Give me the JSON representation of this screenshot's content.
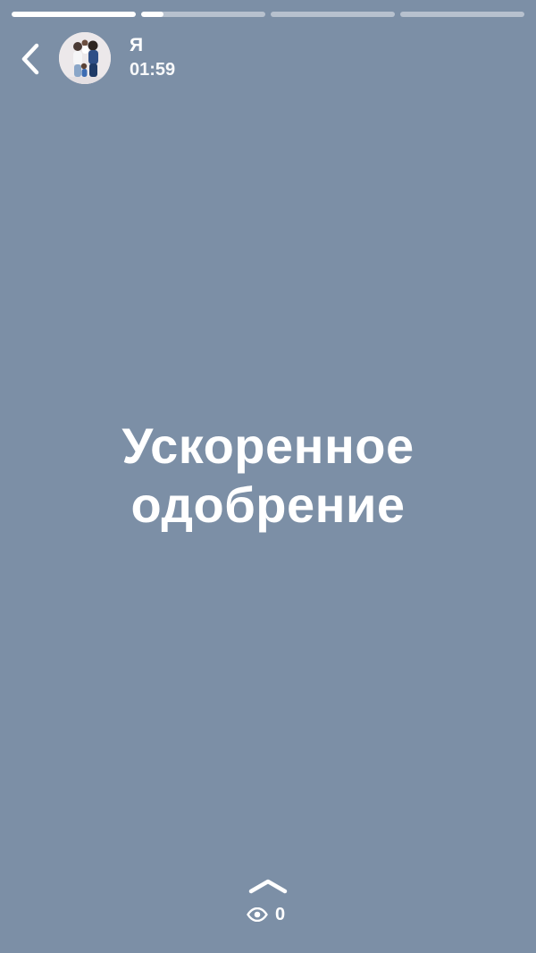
{
  "story": {
    "background_color": "#7c8fa6",
    "progress_segments": [
      {
        "fill": 1.0
      },
      {
        "fill": 0.18
      },
      {
        "fill": 0.0
      },
      {
        "fill": 0.0
      }
    ]
  },
  "header": {
    "back_icon": "chevron-left-icon",
    "user_name": "Я",
    "time": "01:59"
  },
  "content": {
    "headline_line1": "Ускоренное",
    "headline_line2": "одобрение"
  },
  "footer": {
    "swipe_icon": "chevron-up-icon",
    "views_icon": "eye-icon",
    "views_count": "0"
  }
}
